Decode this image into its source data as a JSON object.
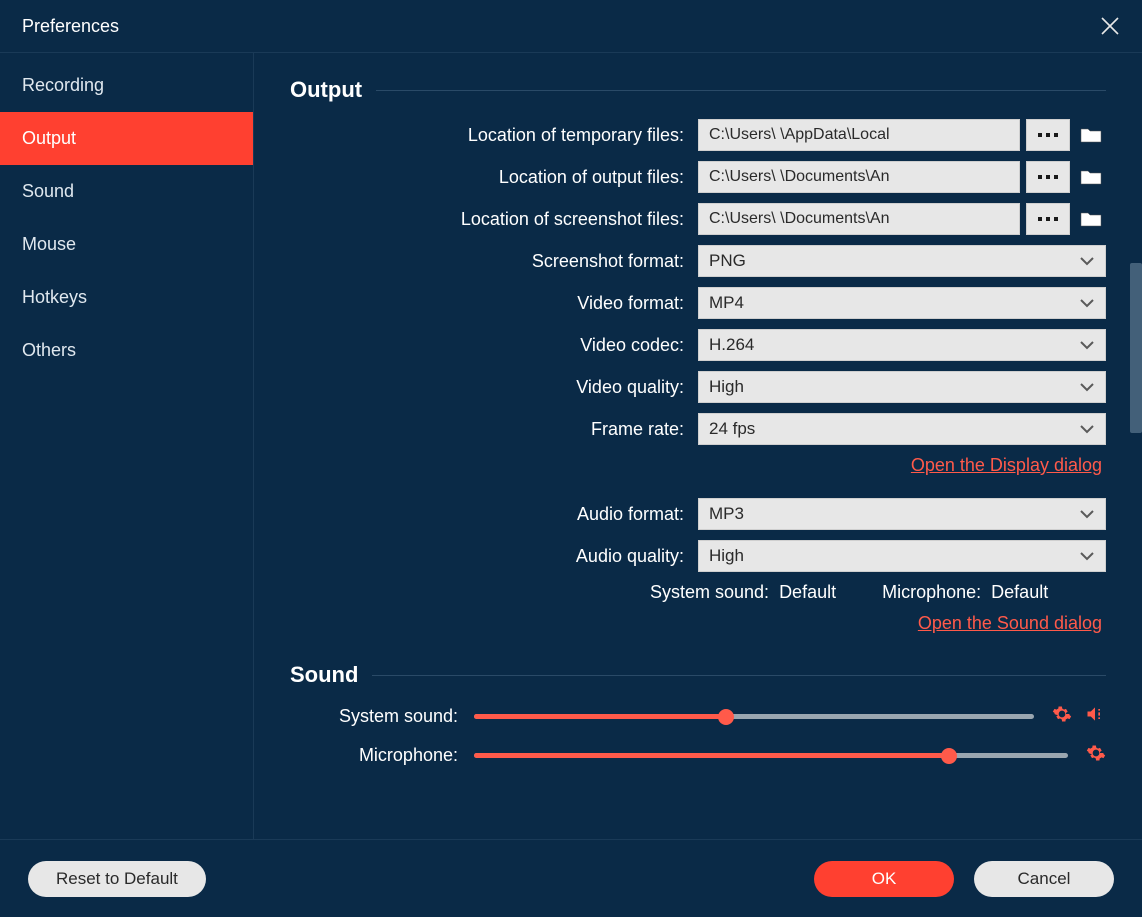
{
  "title": "Preferences",
  "sidebar": {
    "items": [
      {
        "label": "Recording"
      },
      {
        "label": "Output"
      },
      {
        "label": "Sound"
      },
      {
        "label": "Mouse"
      },
      {
        "label": "Hotkeys"
      },
      {
        "label": "Others"
      }
    ],
    "active_index": 1
  },
  "output": {
    "heading": "Output",
    "rows": {
      "temp_files_label": "Location of temporary files:",
      "temp_files_value": "C:\\Users\\          \\AppData\\Local",
      "output_files_label": "Location of output files:",
      "output_files_value": "C:\\Users\\          \\Documents\\An",
      "screenshot_files_label": "Location of screenshot files:",
      "screenshot_files_value": "C:\\Users\\          \\Documents\\An",
      "screenshot_format_label": "Screenshot format:",
      "screenshot_format_value": "PNG",
      "video_format_label": "Video format:",
      "video_format_value": "MP4",
      "video_codec_label": "Video codec:",
      "video_codec_value": "H.264",
      "video_quality_label": "Video quality:",
      "video_quality_value": "High",
      "frame_rate_label": "Frame rate:",
      "frame_rate_value": "24 fps",
      "audio_format_label": "Audio format:",
      "audio_format_value": "MP3",
      "audio_quality_label": "Audio quality:",
      "audio_quality_value": "High",
      "display_link": "Open the Display dialog",
      "sound_link": "Open the Sound dialog",
      "system_sound_label": "System sound:",
      "system_sound_value": "Default",
      "microphone_label": "Microphone:",
      "microphone_value": "Default"
    }
  },
  "sound": {
    "heading": "Sound",
    "system_sound_label": "System sound:",
    "system_sound_level": 45,
    "microphone_label": "Microphone:",
    "microphone_level": 80
  },
  "footer": {
    "reset_label": "Reset to Default",
    "ok_label": "OK",
    "cancel_label": "Cancel"
  }
}
